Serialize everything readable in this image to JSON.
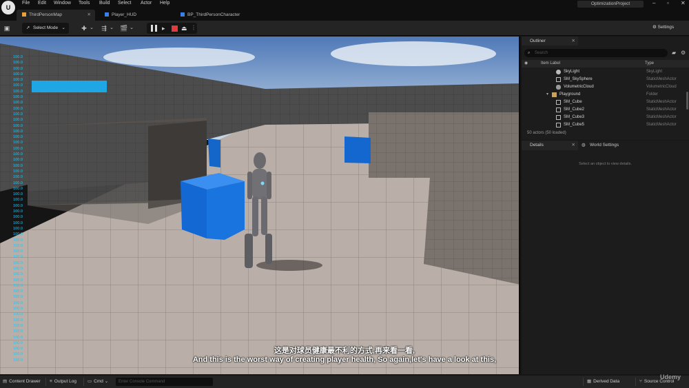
{
  "menu": [
    "File",
    "Edit",
    "Window",
    "Tools",
    "Build",
    "Select",
    "Actor",
    "Help"
  ],
  "project_name": "OptimizationProject",
  "window_controls": [
    "–",
    "▫",
    "✕"
  ],
  "tabs": [
    {
      "label": "ThirdPersonMap",
      "close": "✕"
    },
    {
      "label": "Player_HUD"
    },
    {
      "label": "BP_ThirdPersonCharacter"
    }
  ],
  "toolbar": {
    "select_mode": "Select Mode",
    "settings": "Settings"
  },
  "viewport": {
    "stat_values": [
      "100.0",
      "100.0",
      "100.0",
      "100.0",
      "100.0",
      "100.0",
      "100.0",
      "100.0",
      "100.0",
      "100.0",
      "100.0",
      "100.0",
      "100.0",
      "100.0",
      "100.0",
      "100.0",
      "100.0",
      "100.0",
      "100.0",
      "100.0",
      "100.0",
      "100.0",
      "100.0",
      "100.0",
      "100.0",
      "100.0",
      "100.0",
      "100.0",
      "100.0",
      "100.0",
      "100.0",
      "100.0",
      "100.0",
      "100.0",
      "100.0",
      "100.0",
      "100.0",
      "100.0",
      "100.0",
      "100.0",
      "100.0",
      "100.0",
      "100.0",
      "100.0",
      "100.0",
      "100.0",
      "100.0",
      "100.0",
      "100.0",
      "100.0",
      "100.0",
      "100.0",
      "100.0",
      "100.0"
    ],
    "subtitle_cn": "这是对球员健康最不利的方式,再来看一看,",
    "subtitle_en": "And this is the worst way of creating player health, So again,let's have a look at this,"
  },
  "outliner": {
    "tab_label": "Outliner",
    "close": "✕",
    "search_placeholder": "Search",
    "col_label": "Item Label",
    "col_type": "Type",
    "rows": [
      {
        "label": "SkyLight",
        "type": "SkyLight"
      },
      {
        "label": "SM_SkySphere",
        "type": "StaticMeshActor"
      },
      {
        "label": "VolumetricCloud",
        "type": "VolumetricCloud"
      },
      {
        "label": "Playground",
        "type": "Folder"
      },
      {
        "label": "SM_Cube",
        "type": "StaticMeshActor"
      },
      {
        "label": "SM_Cube2",
        "type": "StaticMeshActor"
      },
      {
        "label": "SM_Cube3",
        "type": "StaticMeshActor"
      },
      {
        "label": "SM_Cube5",
        "type": "StaticMeshActor"
      }
    ],
    "footer": "50 actors (50 loaded)"
  },
  "details": {
    "tab_label": "Details",
    "close": "✕",
    "world_tab": "World Settings",
    "empty_text": "Select an object to view details."
  },
  "bottombar": {
    "content_drawer": "Content Drawer",
    "output_log": "Output Log",
    "cmd": "Cmd",
    "console_placeholder": "Enter Console Command",
    "derived_data": "Derived Data",
    "source_control": "Source Control"
  },
  "watermark": "Udemy",
  "colors": {
    "health_bar": "#1fa6e5",
    "stat_text": "#2bc3ee",
    "map_tab_icon": "#e7a33a",
    "blueprint_tab_icon": "#3a7fe7"
  }
}
